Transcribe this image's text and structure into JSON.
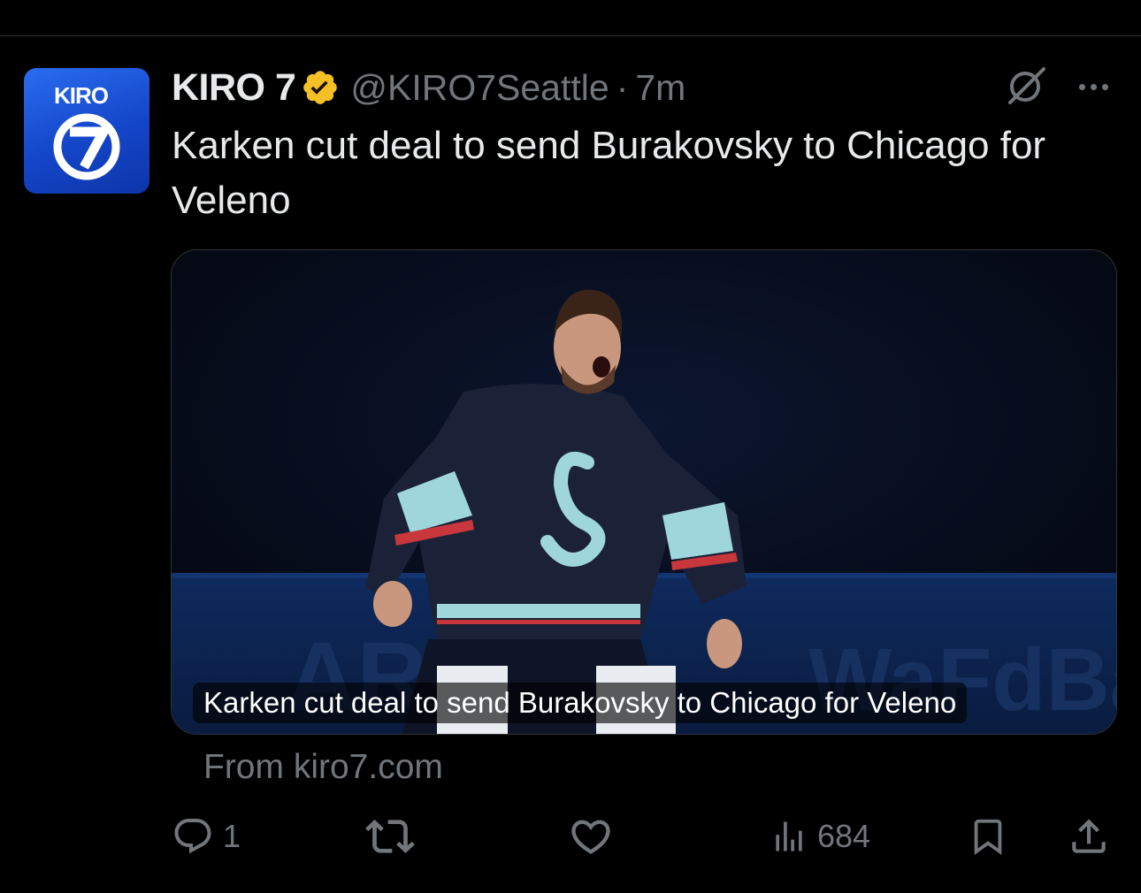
{
  "tweet": {
    "author_name": "KIRO 7",
    "handle": "@KIRO7Seattle",
    "separator": "·",
    "time": "7m",
    "text": "Karken cut deal to send Burakovsky to Chicago for Veleno",
    "avatar": {
      "label": "KIRO",
      "number": "7",
      "color": "#1a56db"
    },
    "verified_color": "#f4c025",
    "card": {
      "caption": "Karken cut deal to send Burakovsky to Chicago for Veleno",
      "source": "From kiro7.com",
      "image_description_icon": "hockey-player-photo"
    },
    "actions": {
      "reply_count": "1",
      "retweet_count": "",
      "like_count": "",
      "views_count": "684"
    }
  },
  "colors": {
    "background": "#000000",
    "text_primary": "#e7e9ea",
    "text_secondary": "#71767b",
    "border": "#2f3336"
  }
}
